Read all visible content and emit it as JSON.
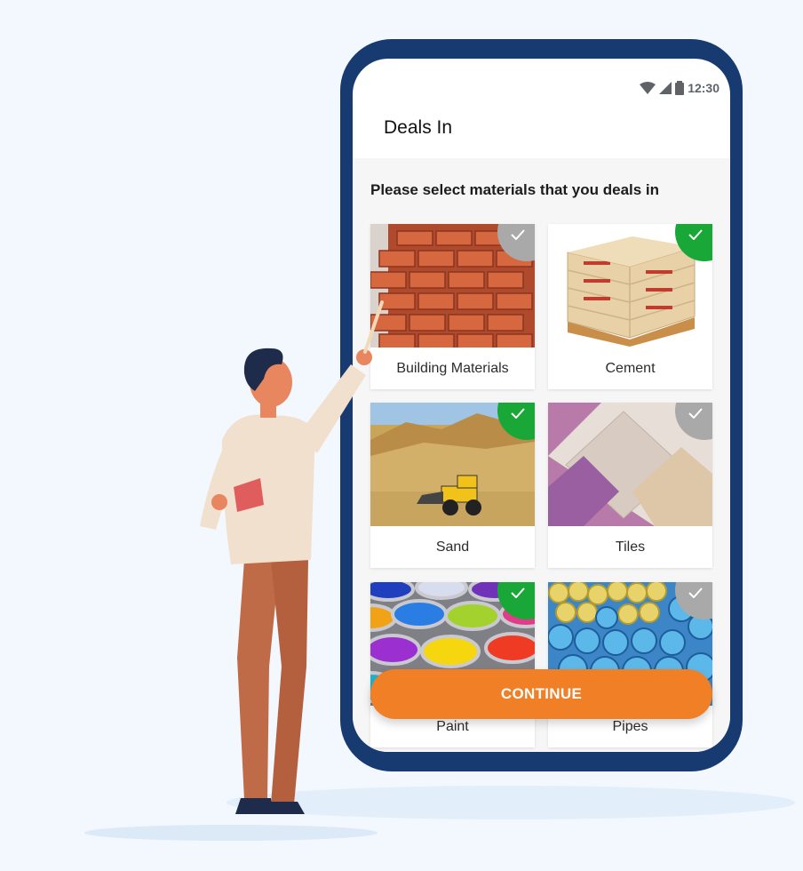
{
  "status_bar": {
    "time": "12:30",
    "icons": [
      "wifi-icon",
      "signal-icon",
      "battery-icon"
    ]
  },
  "app_bar": {
    "title": "Deals In"
  },
  "prompt": "Please select materials that you deals in",
  "materials": [
    {
      "label": "Building Materials",
      "selected": false,
      "image": "bricks-image"
    },
    {
      "label": "Cement",
      "selected": true,
      "image": "cement-bags-image"
    },
    {
      "label": "Sand",
      "selected": true,
      "image": "sand-quarry-image"
    },
    {
      "label": "Tiles",
      "selected": false,
      "image": "tiles-image"
    },
    {
      "label": "Paint",
      "selected": true,
      "image": "paint-cans-image"
    },
    {
      "label": "Pipes",
      "selected": false,
      "image": "pipes-image"
    }
  ],
  "continue_label": "CONTINUE",
  "colors": {
    "accent": "#f07f26",
    "selected": "#19a837",
    "unselected": "#a9a9a9",
    "phone_frame": "#173a70"
  }
}
